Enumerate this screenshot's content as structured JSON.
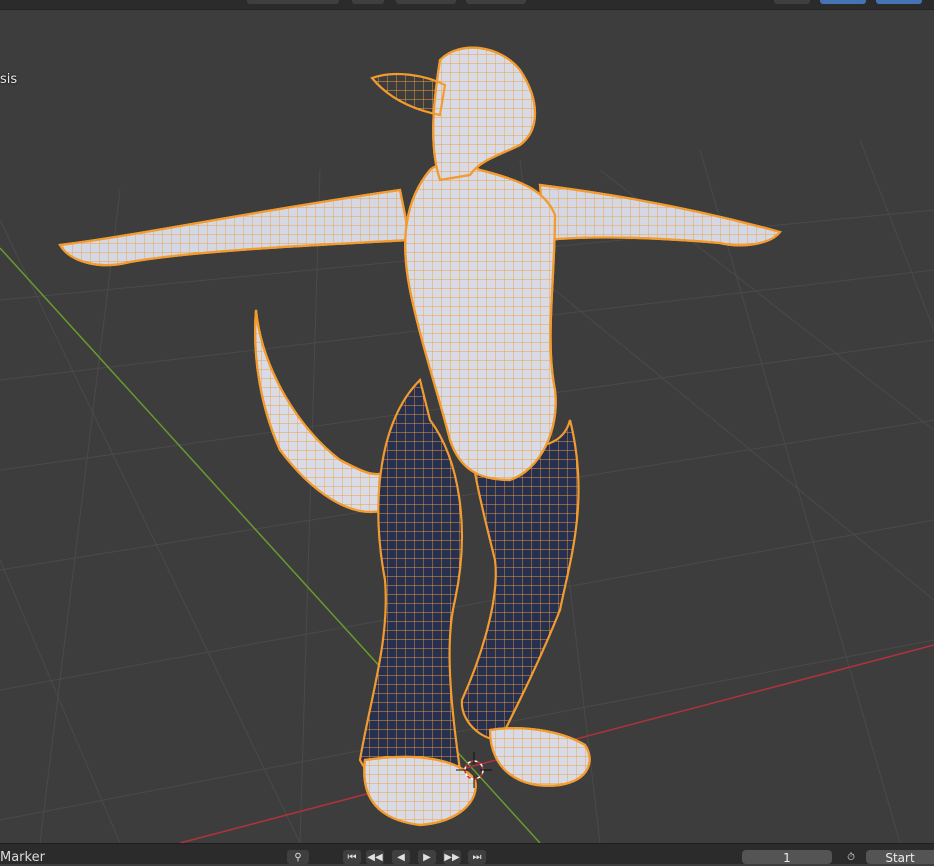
{
  "viewport": {
    "overlay_text": "sis",
    "selection_color": "#f29b2f",
    "grid_x_axis_color": "#b0323c",
    "grid_y_axis_color": "#6a9a2e",
    "background_color": "#3d3d3d",
    "icons": [
      "3d-cursor-icon"
    ]
  },
  "timeline": {
    "marker_label": "Marker",
    "current_frame": "1",
    "start_label": "Start",
    "icons": [
      "search-icon",
      "jump-start-icon",
      "prev-keyframe-icon",
      "play-reverse-icon",
      "play-icon",
      "next-keyframe-icon",
      "jump-end-icon",
      "stopwatch-icon"
    ]
  }
}
